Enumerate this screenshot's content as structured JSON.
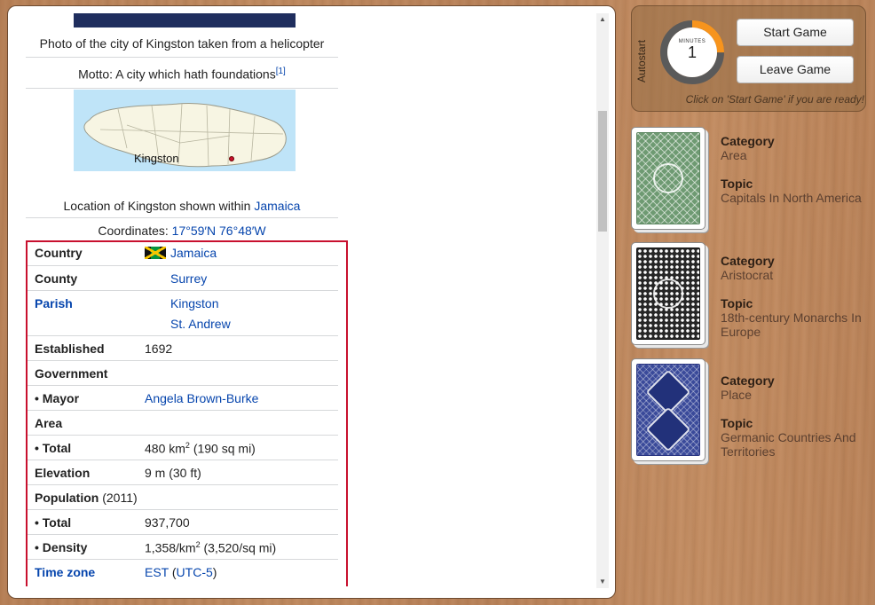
{
  "infobox": {
    "photo_caption": "Photo of the city of Kingston taken from a helicopter",
    "motto_prefix": "Motto: A city which hath foundations",
    "motto_ref": "[1]",
    "map_label": "Kingston",
    "location_prefix": "Location of Kingston shown within ",
    "location_link": "Jamaica",
    "coords_prefix": "Coordinates: ",
    "coords_value": "17°59′N 76°48′W",
    "rows": {
      "country": {
        "label": "Country",
        "value": "Jamaica"
      },
      "county": {
        "label": "County",
        "value": "Surrey"
      },
      "parish": {
        "label": "Parish",
        "value1": "Kingston",
        "value2": "St. Andrew"
      },
      "established": {
        "label": "Established",
        "value": "1692"
      },
      "government": {
        "label": "Government"
      },
      "mayor": {
        "label": "• Mayor",
        "value": "Angela Brown-Burke"
      },
      "area": {
        "label": "Area"
      },
      "area_total": {
        "label": "• Total",
        "value_pre": "480 km",
        "sup": "2",
        "value_post": " (190 sq mi)"
      },
      "elevation": {
        "label": "Elevation",
        "value": "9 m (30 ft)"
      },
      "population": {
        "label": "Population",
        "year": " (2011)"
      },
      "pop_total": {
        "label": "• Total",
        "value": "937,700"
      },
      "density": {
        "label": "• Density",
        "value_pre": "1,358/km",
        "sup": "2",
        "value_post": " (3,520/sq mi)"
      },
      "timezone": {
        "label": "Time zone",
        "value_main": "EST",
        "value_paren_open": " (",
        "value_link": "UTC-5",
        "value_paren_close": ")"
      }
    }
  },
  "control": {
    "autostart_label": "Autostart",
    "timer_unit": "MINUTES",
    "timer_value": "1",
    "timer_fraction": 0.25,
    "start_button": "Start Game",
    "leave_button": "Leave Game",
    "hint": "Click on 'Start Game' if you are ready!",
    "accent": "#f7941d"
  },
  "cards": [
    {
      "category_label": "Category",
      "category": "Area",
      "topic_label": "Topic",
      "topic": "Capitals In North America",
      "color": "#6e9a72"
    },
    {
      "category_label": "Category",
      "category": "Aristocrat",
      "topic_label": "Topic",
      "topic": "18th-century Monarchs In Europe",
      "color": "#262626"
    },
    {
      "category_label": "Category",
      "category": "Place",
      "topic_label": "Topic",
      "topic": "Germanic Countries And Territories",
      "color": "#3a4a9a"
    }
  ]
}
